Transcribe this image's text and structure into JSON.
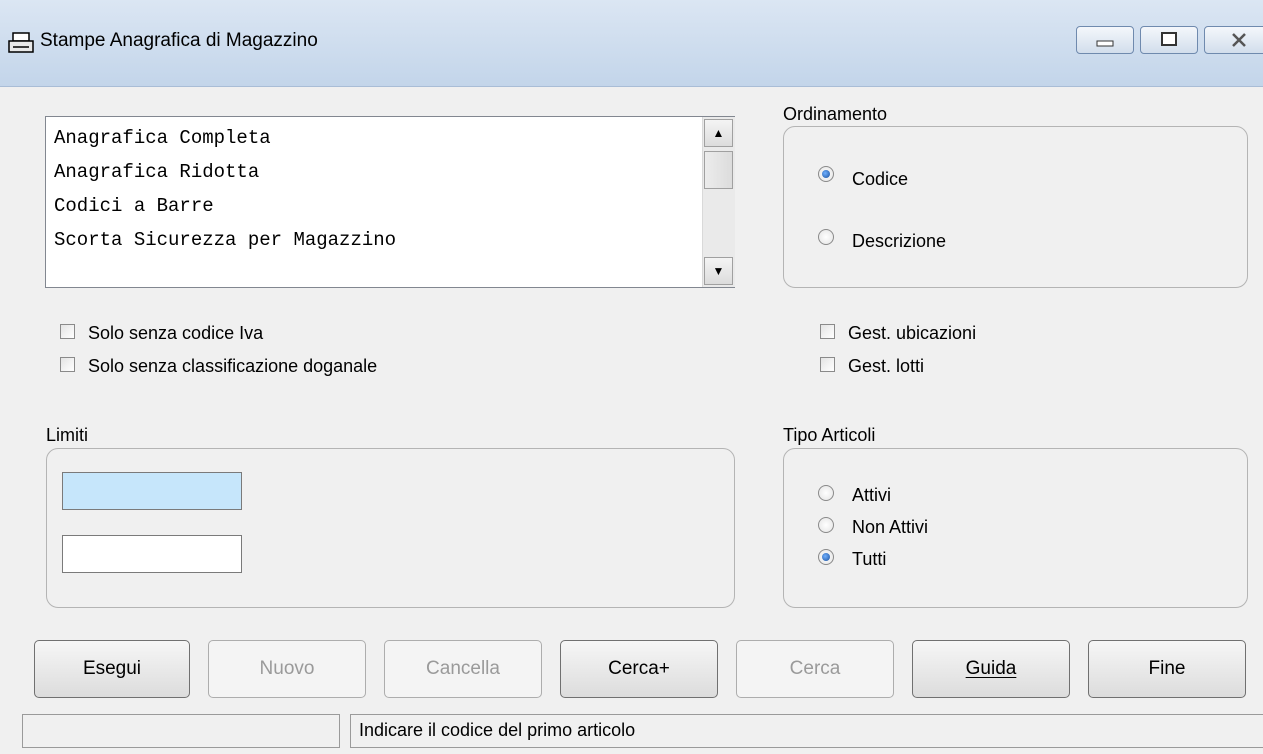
{
  "window": {
    "title": "Stampe Anagrafica di Magazzino",
    "icon": "printer-icon"
  },
  "report_list": {
    "items": [
      "Anagrafica Completa",
      "Anagrafica Ridotta",
      "Codici a Barre",
      "Scorta Sicurezza per Magazzino"
    ]
  },
  "ordinamento": {
    "label": "Ordinamento",
    "options": [
      "Codice",
      "Descrizione"
    ],
    "selected": "Codice"
  },
  "filters": {
    "solo_senza_iva": "Solo senza codice Iva",
    "solo_senza_doganale": "Solo senza classificazione doganale",
    "gest_ubicazioni": "Gest. ubicazioni",
    "gest_lotti": "Gest. lotti"
  },
  "limiti": {
    "label": "Limiti",
    "from_value": "",
    "to_value": ""
  },
  "tipo_articoli": {
    "label": "Tipo Articoli",
    "options": [
      "Attivi",
      "Non Attivi",
      "Tutti"
    ],
    "selected": "Tutti"
  },
  "buttons": {
    "esegui": "Esegui",
    "nuovo": "Nuovo",
    "cancella": "Cancella",
    "cerca_plus": "Cerca+",
    "cerca": "Cerca",
    "guida": "Guida",
    "fine": "Fine"
  },
  "status": {
    "left": "",
    "message": "Indicare il codice del primo articolo"
  },
  "colors": {
    "focused_input": "#c6e6fb",
    "radio_selected": "#1a4f9c"
  }
}
